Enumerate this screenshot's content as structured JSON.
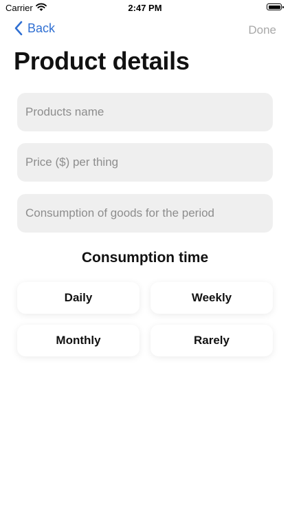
{
  "status_bar": {
    "carrier": "Carrier",
    "time": "2:47 PM"
  },
  "nav": {
    "back_label": "Back",
    "done_label": "Done"
  },
  "page": {
    "title": "Product details"
  },
  "form": {
    "product_name": {
      "value": "",
      "placeholder": "Products name"
    },
    "price": {
      "value": "",
      "placeholder": "Price ($) per thing"
    },
    "consumption": {
      "value": "",
      "placeholder": "Consumption of goods for the period"
    }
  },
  "consumption_time": {
    "title": "Consumption time",
    "options": [
      {
        "label": "Daily"
      },
      {
        "label": "Weekly"
      },
      {
        "label": "Monthly"
      },
      {
        "label": "Rarely"
      }
    ]
  },
  "colors": {
    "accent": "#2f6fd2",
    "disabled": "#a8a8a8",
    "field_bg": "#efefef"
  }
}
